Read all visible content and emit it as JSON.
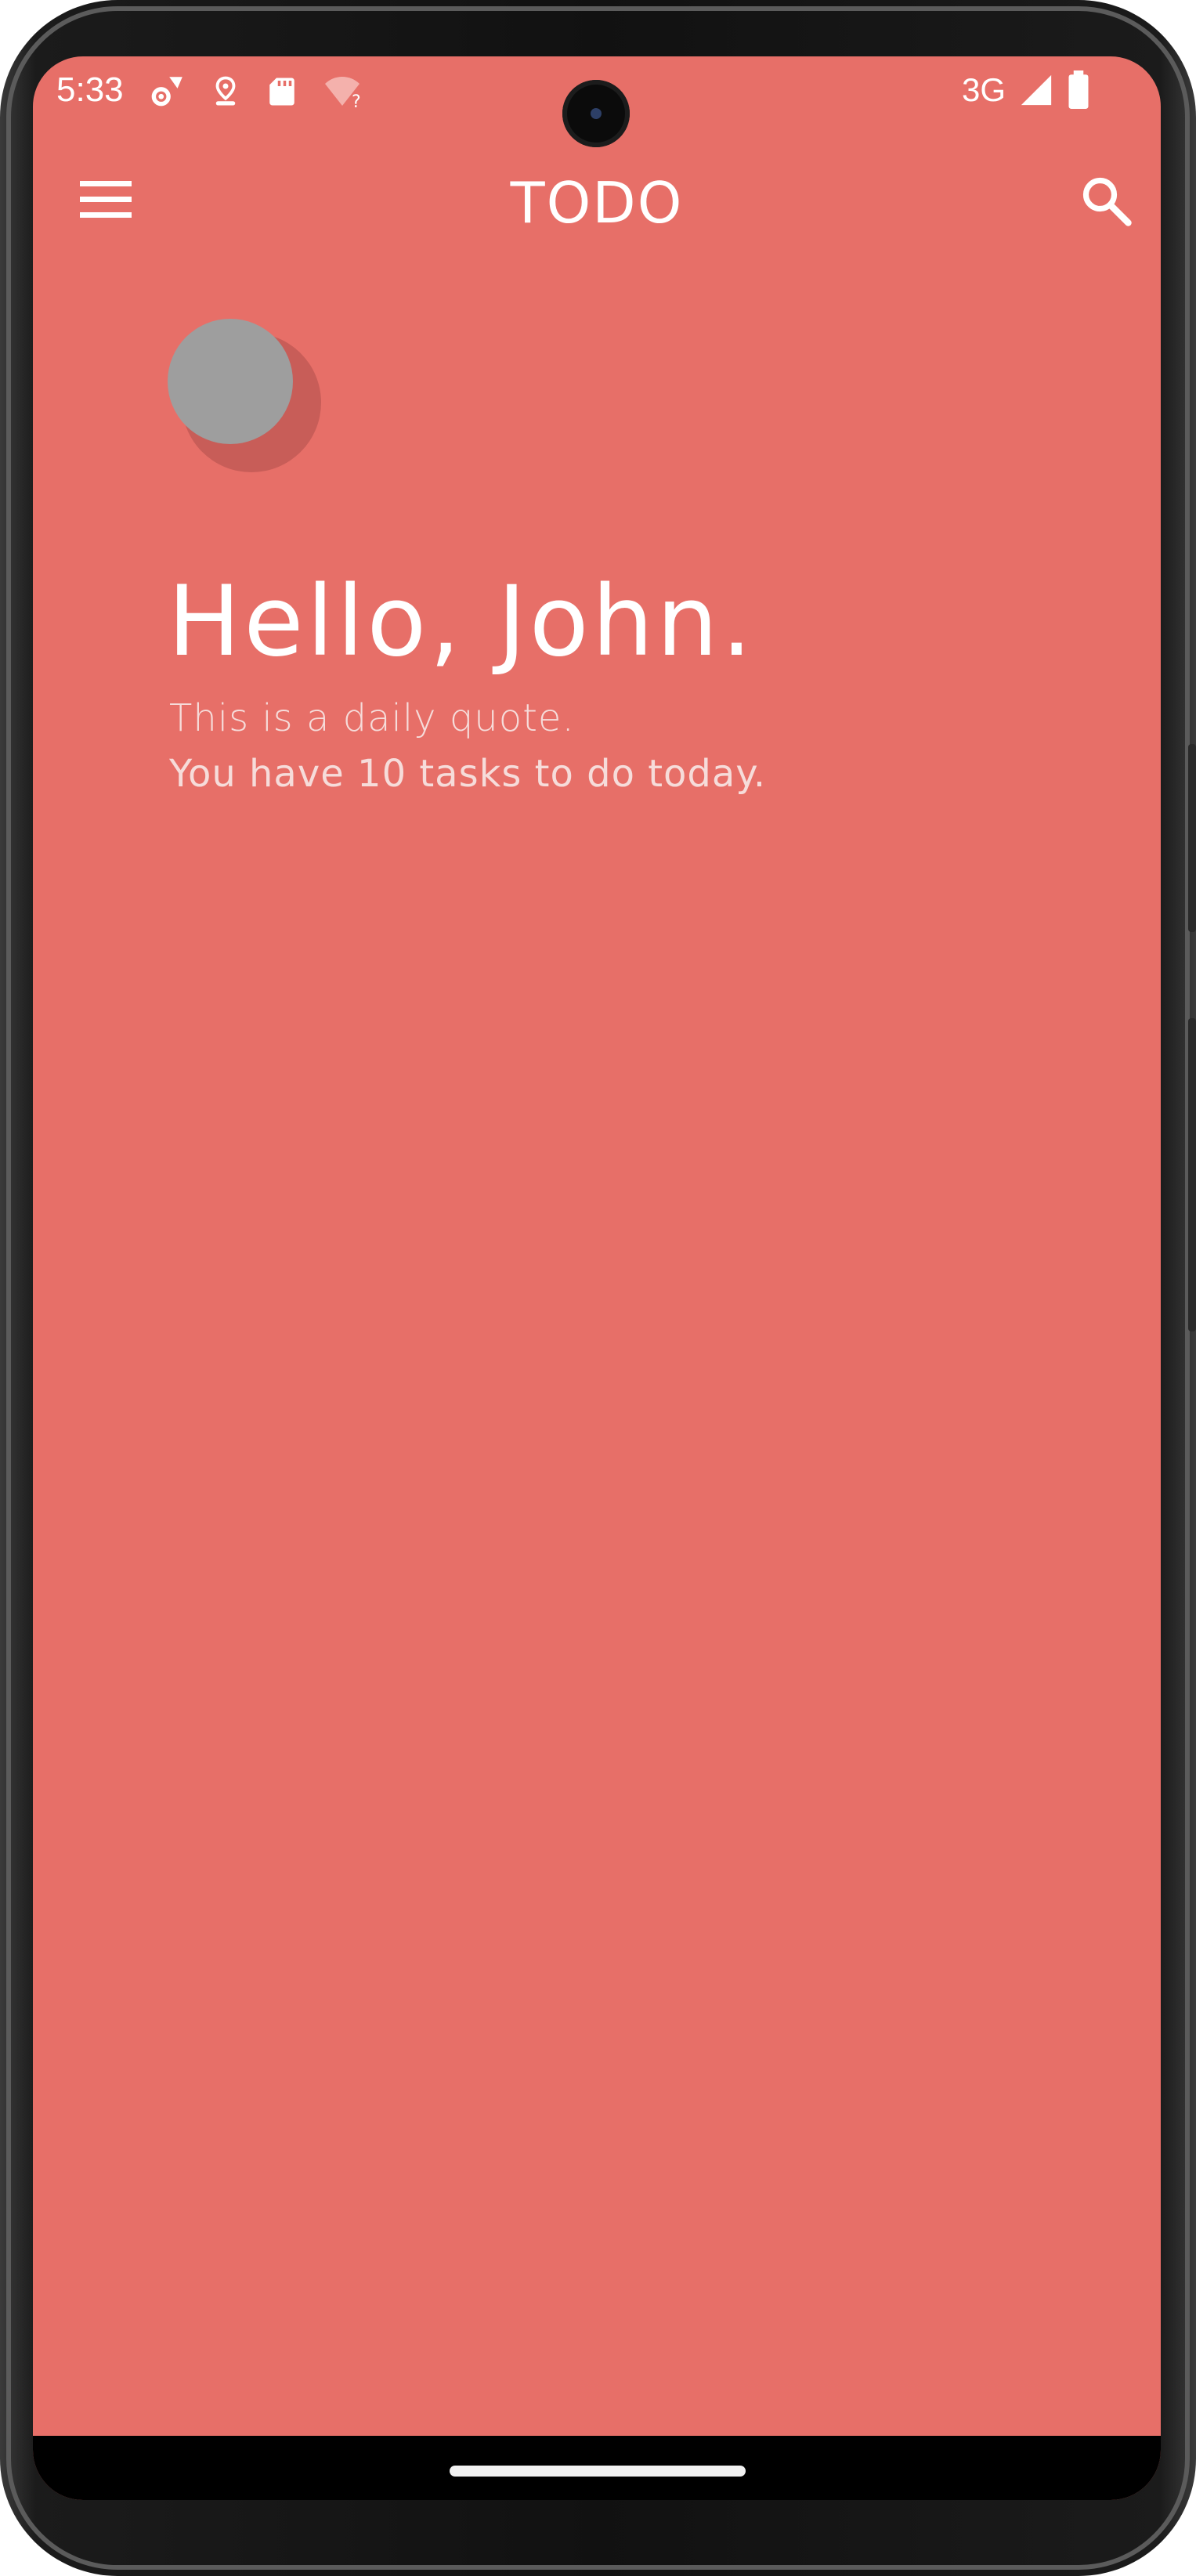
{
  "colors": {
    "background": "#e76f68",
    "text": "#ffffff",
    "subtext": "#f6dcda",
    "avatar": "#9e9e9e"
  },
  "status_bar": {
    "time": "5:33",
    "network": "3G",
    "left_icons": [
      "settings-sync-icon",
      "location-icon",
      "sd-card-icon",
      "wifi-question-icon"
    ],
    "right_icons": [
      "signal-icon",
      "battery-icon"
    ]
  },
  "app_bar": {
    "title": "TODO",
    "left_icon": "menu-icon",
    "right_icon": "search-icon"
  },
  "profile": {
    "greeting": "Hello, John.",
    "quote": "This is a daily quote.",
    "tasks_summary": "You have 10 tasks to do today."
  }
}
